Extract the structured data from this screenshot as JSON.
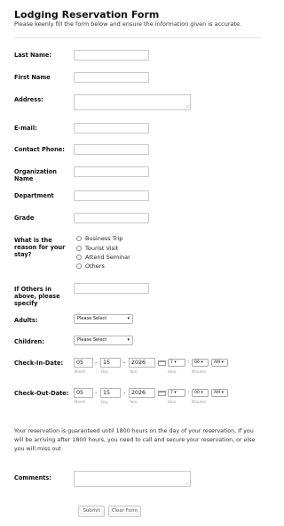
{
  "form": {
    "title": "Lodging Reservation Form",
    "subtitle": "Please keenly fill the form below and ensure the information given is accurate."
  },
  "fields": {
    "last_name": "Last Name:",
    "first_name": "First Name",
    "address": "Address:",
    "email": "E-mail:",
    "contact_phone": "Contact Phone:",
    "organization": "Organization Name",
    "department": "Department",
    "grade": "Grade"
  },
  "reason": {
    "label": "What is the reason for your stay?",
    "options": [
      "Business Trip",
      "Tourist Visit",
      "Attend Seminar",
      "Others"
    ]
  },
  "others": {
    "label": "If Others in above, please specify"
  },
  "adults": {
    "label": "Adults:",
    "value": "Please Select"
  },
  "children": {
    "label": "Children:",
    "value": "Please Select"
  },
  "checkin": {
    "label": "Check-In-Date:",
    "month": "05",
    "day": "15",
    "year": "2026",
    "hour": "7",
    "minutes": "00",
    "ampm": "AM"
  },
  "checkout": {
    "label": "Check-Out-Date:",
    "month": "05",
    "day": "15",
    "year": "2026",
    "hour": "7",
    "minutes": "00",
    "ampm": "AM"
  },
  "date_sublabels": {
    "month": "Month",
    "day": "Day",
    "year": "Year",
    "hour": "Hour",
    "minutes": "Minutes"
  },
  "date_sep": "-",
  "time_sep": ":",
  "notice": "Your reservation is guaranteed until 1800 hours on the day of your reservation. If you will be arriving after 1800 hours, you need to call and secure your reservation, or else you will miss out",
  "comments": {
    "label": "Comments:"
  },
  "buttons": {
    "submit": "Submit",
    "clear": "Clear Form"
  },
  "icons": {
    "calendar": "calendar-icon",
    "dropdown": "chevron-down-icon",
    "resize": "resize-handle-icon"
  }
}
